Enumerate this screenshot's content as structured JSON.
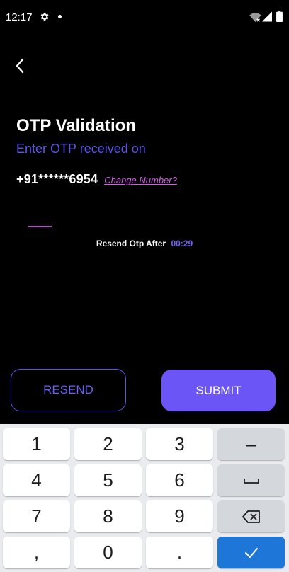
{
  "status_bar": {
    "time": "12:17",
    "icons": [
      "gear-icon",
      "notification-dot-icon",
      "wifi-off-icon",
      "cell-signal-icon",
      "battery-icon"
    ]
  },
  "header": {
    "back_icon": "chevron-left-icon"
  },
  "otp": {
    "title": "OTP Validation",
    "subtitle": "Enter OTP received on",
    "phone": "+91******6954",
    "change_link": "Change Number?",
    "resend_label": "Resend Otp After",
    "timer": "00:29"
  },
  "actions": {
    "resend_label": "RESEND",
    "submit_label": "SUBMIT"
  },
  "keyboard": {
    "keys": {
      "k1": "1",
      "k2": "2",
      "k3": "3",
      "minus": "–",
      "k4": "4",
      "k5": "5",
      "k6": "6",
      "k7": "7",
      "k8": "8",
      "k9": "9",
      "comma": ",",
      "k0": "0",
      "period": "."
    },
    "icons": [
      "space-icon",
      "backspace-icon",
      "checkmark-icon"
    ]
  },
  "colors": {
    "background": "#000000",
    "accent": "#6b55f6",
    "subtitle": "#5f56e6",
    "link": "#d45ce8",
    "otp_underline": "#b44fc6",
    "keyboard_bg": "#e9ebee",
    "enter_key": "#1d76d8"
  }
}
